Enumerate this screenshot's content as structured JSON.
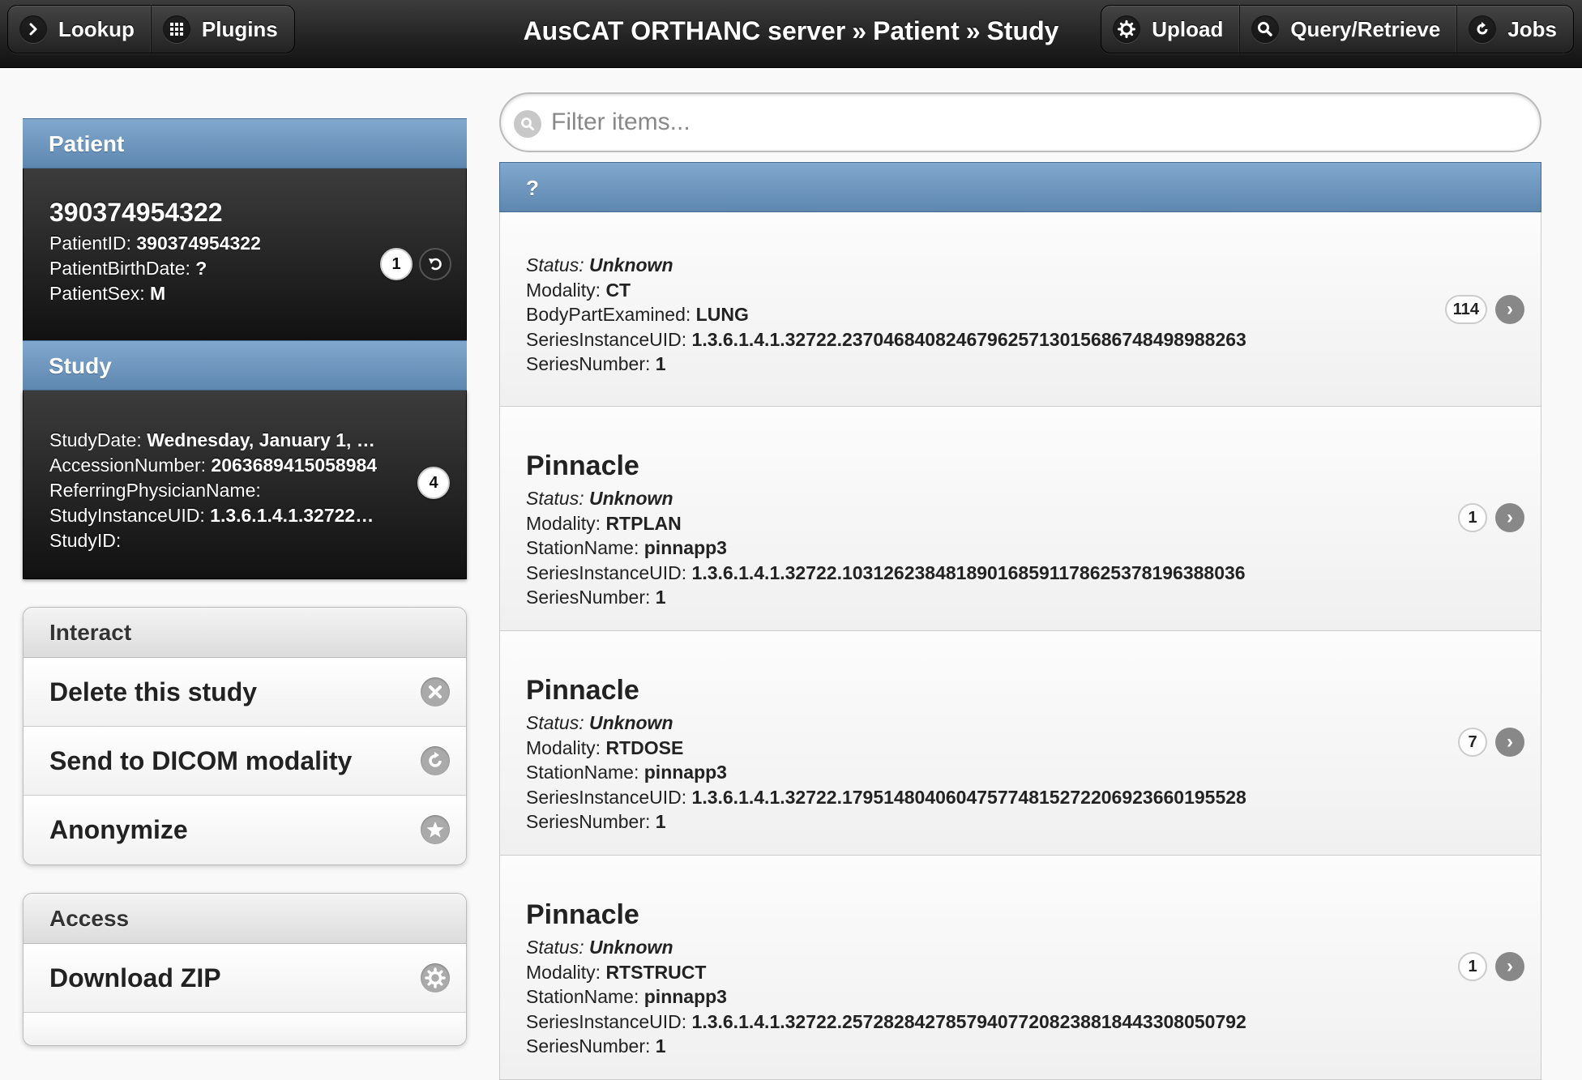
{
  "header": {
    "left_buttons": [
      {
        "label": "Lookup",
        "icon": "chevron-right-icon"
      },
      {
        "label": "Plugins",
        "icon": "grid-icon"
      }
    ],
    "breadcrumb": [
      "AusCAT ORTHANC server",
      "Patient",
      "Study"
    ],
    "breadcrumb_sep": "»",
    "right_buttons": [
      {
        "label": "Upload",
        "icon": "gear-icon"
      },
      {
        "label": "Query/Retrieve",
        "icon": "search-icon"
      },
      {
        "label": "Jobs",
        "icon": "refresh-icon"
      }
    ]
  },
  "patient": {
    "section_label": "Patient",
    "name": "390374954322",
    "fields": [
      {
        "key": "PatientID:",
        "value": "390374954322"
      },
      {
        "key": "PatientBirthDate:",
        "value": "?"
      },
      {
        "key": "PatientSex:",
        "value": "M"
      }
    ],
    "count": "1"
  },
  "study": {
    "section_label": "Study",
    "fields": [
      {
        "key": "StudyDate:",
        "value": "Wednesday, January 1, …"
      },
      {
        "key": "AccessionNumber:",
        "value": "2063689415058984"
      },
      {
        "key": "ReferringPhysicianName:",
        "value": ""
      },
      {
        "key": "StudyInstanceUID:",
        "value": "1.3.6.1.4.1.32722…"
      },
      {
        "key": "StudyID:",
        "value": ""
      }
    ],
    "count": "4"
  },
  "interact": {
    "title": "Interact",
    "items": [
      {
        "label": "Delete this study",
        "icon": "delete-icon"
      },
      {
        "label": "Send to DICOM modality",
        "icon": "send-icon"
      },
      {
        "label": "Anonymize",
        "icon": "star-icon"
      }
    ]
  },
  "access": {
    "title": "Access",
    "items": [
      {
        "label": "Download ZIP",
        "icon": "gear-icon"
      }
    ]
  },
  "filter": {
    "placeholder": "Filter items..."
  },
  "series_header": "?",
  "series": [
    {
      "name": "",
      "status_key": "Status:",
      "status": "Unknown",
      "fields": [
        {
          "key": "Modality:",
          "value": "CT"
        },
        {
          "key": "BodyPartExamined:",
          "value": "LUNG"
        },
        {
          "key": "SeriesInstanceUID:",
          "value": "1.3.6.1.4.1.32722.237046840824679625713015686748498988263"
        },
        {
          "key": "SeriesNumber:",
          "value": "1"
        }
      ],
      "count": "114"
    },
    {
      "name": "Pinnacle",
      "status_key": "Status:",
      "status": "Unknown",
      "fields": [
        {
          "key": "Modality:",
          "value": "RTPLAN"
        },
        {
          "key": "StationName:",
          "value": "pinnapp3"
        },
        {
          "key": "SeriesInstanceUID:",
          "value": "1.3.6.1.4.1.32722.103126238481890168591178625378196388036"
        },
        {
          "key": "SeriesNumber:",
          "value": "1"
        }
      ],
      "count": "1"
    },
    {
      "name": "Pinnacle",
      "status_key": "Status:",
      "status": "Unknown",
      "fields": [
        {
          "key": "Modality:",
          "value": "RTDOSE"
        },
        {
          "key": "StationName:",
          "value": "pinnapp3"
        },
        {
          "key": "SeriesInstanceUID:",
          "value": "1.3.6.1.4.1.32722.179514804060475774815272206923660195528"
        },
        {
          "key": "SeriesNumber:",
          "value": "1"
        }
      ],
      "count": "7"
    },
    {
      "name": "Pinnacle",
      "status_key": "Status:",
      "status": "Unknown",
      "fields": [
        {
          "key": "Modality:",
          "value": "RTSTRUCT"
        },
        {
          "key": "StationName:",
          "value": "pinnapp3"
        },
        {
          "key": "SeriesInstanceUID:",
          "value": "1.3.6.1.4.1.32722.257282842785794077208238818443308050792"
        },
        {
          "key": "SeriesNumber:",
          "value": "1"
        }
      ],
      "count": "1"
    }
  ]
}
